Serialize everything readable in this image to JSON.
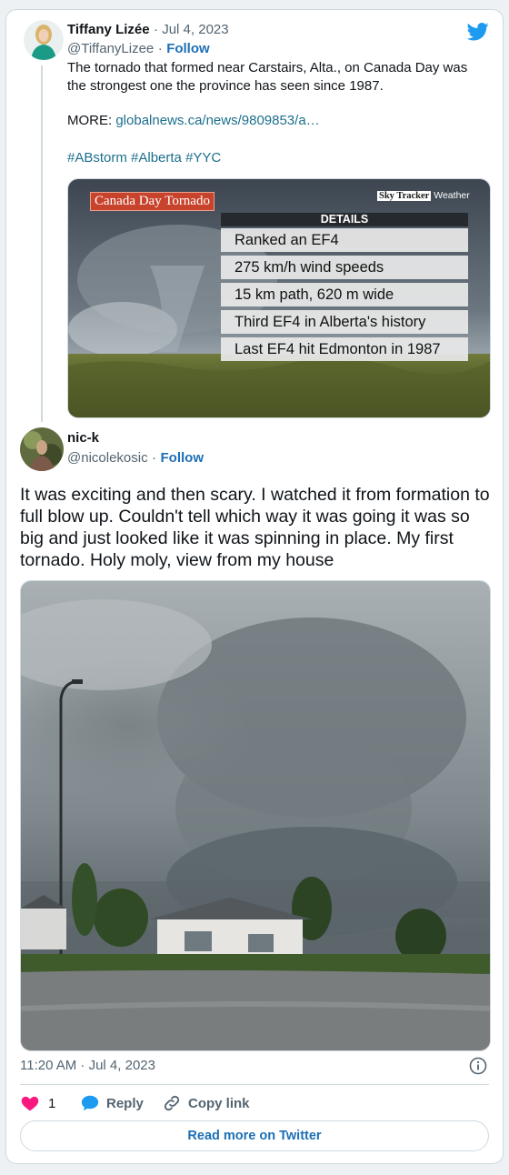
{
  "tweet1": {
    "author_name": "Tiffany Lizée",
    "sep_date": "· Jul 4, 2023",
    "handle": "@TiffanyLizee",
    "sep": "·",
    "follow": "Follow",
    "text_line1": "The tornado that formed near Carstairs, Alta., on Canada Day was",
    "text_line2": "the strongest one the province has seen since 1987.",
    "more_prefix": "MORE:",
    "more_link": "globalnews.ca/news/9809853/a…",
    "hashtags": [
      "#ABstorm",
      "#Alberta",
      "#YYC"
    ],
    "media": {
      "banner": "Canada Day Tornado",
      "brand_box": "Sky Tracker",
      "brand_word": "Weather",
      "details_header": "DETAILS",
      "details": [
        "Ranked an EF4",
        "275 km/h wind speeds",
        "15 km path, 620 m wide",
        "Third EF4 in Alberta's history",
        "Last EF4 hit Edmonton in 1987"
      ]
    }
  },
  "tweet2": {
    "author_name": "nic-k",
    "handle": "@nicolekosic",
    "sep": "·",
    "follow": "Follow",
    "text": "It was exciting and then scary. I watched it from formation to full blow up. Couldn't tell which way it was going it was so big and just looked like it was spinning in place. My first tornado. Holy moly, view from my house",
    "timestamp": "11:20 AM · Jul 4, 2023",
    "likes": "1",
    "reply_label": "Reply",
    "copy_label": "Copy link",
    "read_more": "Read more on Twitter"
  },
  "colors": {
    "twitter_blue": "#1d9bf0",
    "like_pink": "#f91880"
  }
}
